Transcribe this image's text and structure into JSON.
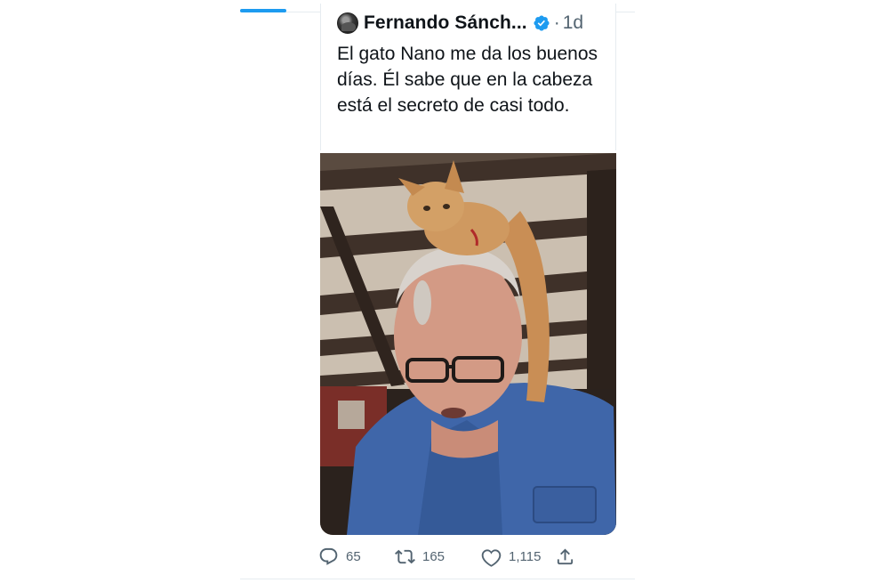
{
  "tweet": {
    "author_name": "Fernando Sánch...",
    "separator": "·",
    "time": "1d",
    "text": "El gato Nano me da los buenos días. Él sabe que en la cabeza está el secreto de casi todo."
  },
  "actions": {
    "replies": "65",
    "retweets": "165",
    "likes": "1,115"
  },
  "icons": {
    "verified": "verified-badge-icon",
    "reply": "reply-icon",
    "retweet": "retweet-icon",
    "like": "heart-icon",
    "share": "share-icon"
  },
  "colors": {
    "accent": "#1d9bf0",
    "secondary_text": "#536471",
    "divider": "#e6ecf0"
  }
}
